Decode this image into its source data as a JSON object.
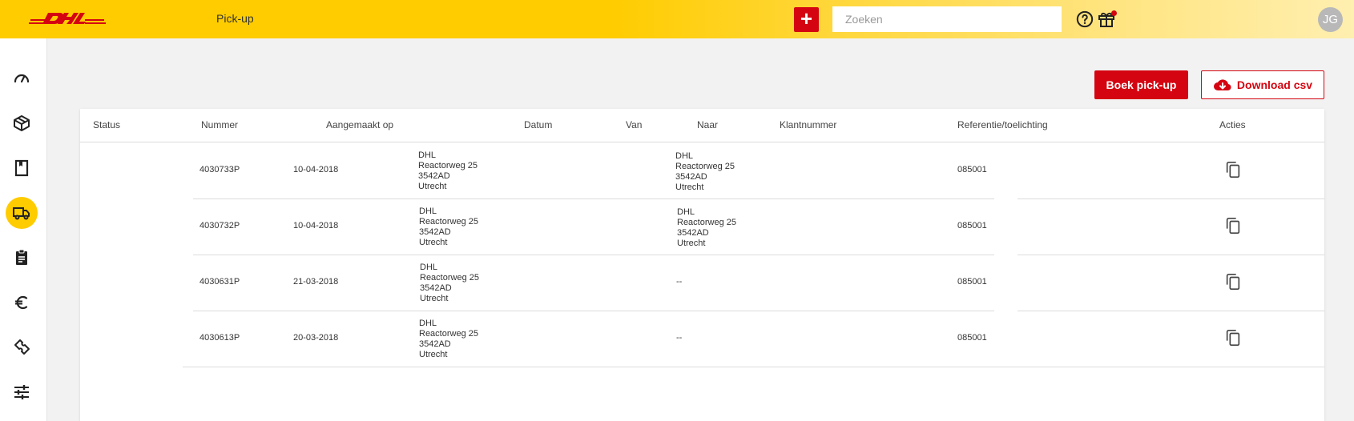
{
  "header": {
    "logo_text": "DHL",
    "title": "Pick-up",
    "add_label": "+",
    "search_placeholder": "Zoeken",
    "avatar_initials": "JG"
  },
  "sidebar": {
    "items": [
      {
        "icon": "speedometer-icon"
      },
      {
        "icon": "package-icon"
      },
      {
        "icon": "bookmark-icon"
      },
      {
        "icon": "truck-icon",
        "active": true
      },
      {
        "icon": "clipboard-icon"
      },
      {
        "icon": "euro-icon"
      },
      {
        "icon": "ticket-icon"
      },
      {
        "icon": "sliders-icon"
      }
    ]
  },
  "actions": {
    "book_label": "Boek pick-up",
    "download_label": "Download csv"
  },
  "table": {
    "columns": [
      "Status",
      "Nummer",
      "Aangemaakt op",
      "Datum",
      "Van",
      "Naar",
      "Klantnummer",
      "Referentie/toelichting",
      "Acties"
    ],
    "rows": [
      {
        "status": "",
        "number": "4030733P",
        "created": "10-04-2018",
        "from": [
          "DHL",
          "Reactorweg 25",
          "3542AD",
          "Utrecht"
        ],
        "to": [
          "DHL",
          "Reactorweg 25",
          "3542AD",
          "Utrecht"
        ],
        "customer": "",
        "reference": "085001"
      },
      {
        "status": "",
        "number": "4030732P",
        "created": "10-04-2018",
        "from": [
          "DHL",
          "Reactorweg 25",
          "3542AD",
          "Utrecht"
        ],
        "to": [
          "DHL",
          "Reactorweg 25",
          "3542AD",
          "Utrecht"
        ],
        "customer": "",
        "reference": "085001"
      },
      {
        "status": "",
        "number": "4030631P",
        "created": "21-03-2018",
        "from": [
          "DHL",
          "Reactorweg 25",
          "3542AD",
          "Utrecht"
        ],
        "to_empty": "--",
        "customer": "",
        "reference": "085001"
      },
      {
        "status": "",
        "number": "4030613P",
        "created": "20-03-2018",
        "from": [
          "DHL",
          "Reactorweg 25",
          "3542AD",
          "Utrecht"
        ],
        "to_empty": "--",
        "customer": "",
        "reference": "085001"
      }
    ]
  },
  "colors": {
    "brand_yellow": "#ffcc00",
    "brand_red": "#d40511"
  }
}
